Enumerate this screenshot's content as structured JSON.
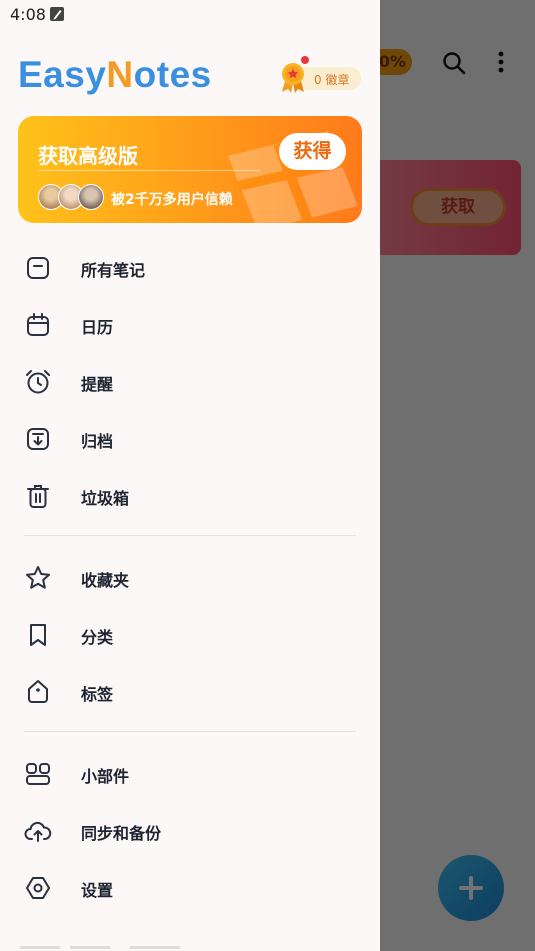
{
  "status_bar": {
    "time": "4:08"
  },
  "background": {
    "pill_text": "0%",
    "card_button": "获取"
  },
  "drawer": {
    "logo": {
      "pre": "Easy",
      "accent": "N",
      "post": "otes"
    },
    "badge": {
      "text": "0 徽章"
    },
    "promo": {
      "title": "获取高级版",
      "button": "获得",
      "subtitle": "被2千万多用户信赖"
    },
    "menu": [
      {
        "label": "所有笔记",
        "icon": "note-icon"
      },
      {
        "label": "日历",
        "icon": "calendar-icon"
      },
      {
        "label": "提醒",
        "icon": "alarm-clock-icon"
      },
      {
        "label": "归档",
        "icon": "archive-icon"
      },
      {
        "label": "垃圾箱",
        "icon": "trash-icon"
      },
      {
        "label": "收藏夹",
        "icon": "star-icon"
      },
      {
        "label": "分类",
        "icon": "bookmark-icon"
      },
      {
        "label": "标签",
        "icon": "tag-icon"
      },
      {
        "label": "小部件",
        "icon": "widgets-icon"
      },
      {
        "label": "同步和备份",
        "icon": "cloud-upload-icon"
      },
      {
        "label": "设置",
        "icon": "settings-hexagon-icon"
      }
    ]
  },
  "colors": {
    "logo_blue": "#3b8fe0",
    "logo_orange": "#f59a24",
    "promo_orange": "#ff9a1a",
    "text_dark": "#1e2430"
  }
}
